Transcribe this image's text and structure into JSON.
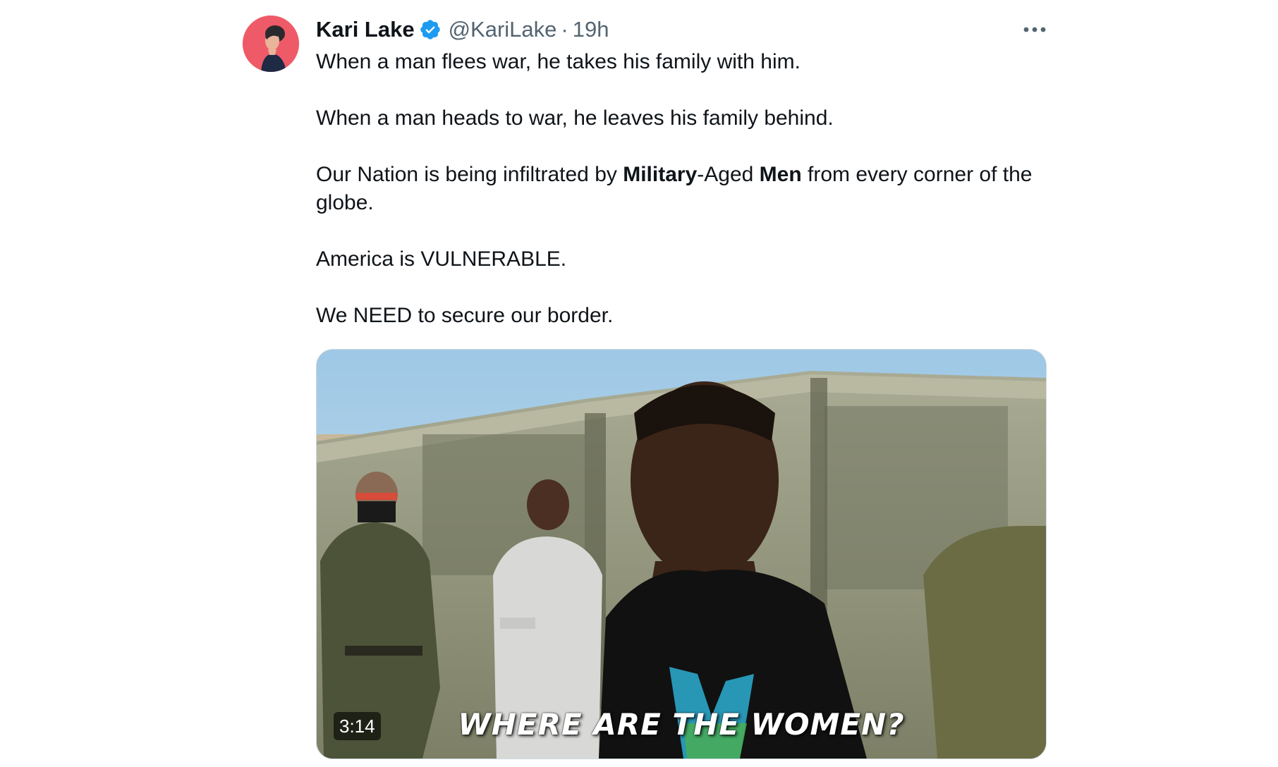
{
  "author": {
    "name": "Kari Lake",
    "handle": "@KariLake",
    "separator": "·",
    "time": "19h",
    "verified": true,
    "verified_color": "#1d9bf0",
    "avatar_icon": "profile-photo"
  },
  "menu": {
    "icon": "more-horizontal-icon"
  },
  "tweet": {
    "line1": "When a man flees war, he takes his family with him.",
    "line2": "When a man heads to war, he leaves his family behind.",
    "line3": {
      "part1": "Our Nation is being infiltrated by ",
      "bold1": "Military",
      "part2": "-Aged ",
      "bold2": "Men",
      "part3": " from every corner of the globe."
    },
    "line4": "America is VULNERABLE.",
    "line5": "We NEED to secure our border."
  },
  "media": {
    "type": "video",
    "duration": "3:14",
    "caption": "WHERE ARE THE WOMEN?"
  },
  "colors": {
    "text": "#0f1419",
    "secondary": "#536471",
    "border": "#cfd9de"
  }
}
